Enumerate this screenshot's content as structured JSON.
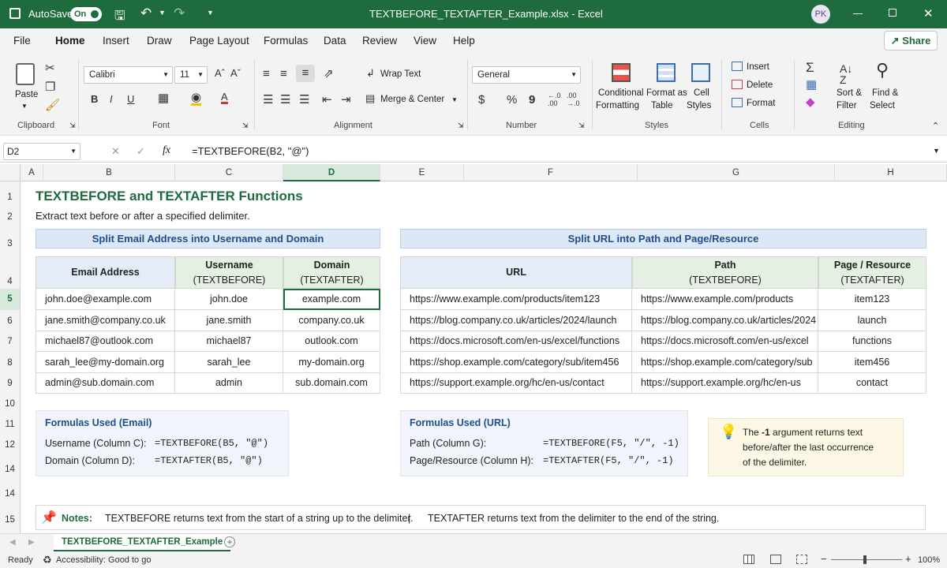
{
  "titlebar": {
    "autosave_label": "AutoSave",
    "autosave_state": "On",
    "title": "TEXTBEFORE_TEXTAFTER_Example.xlsx  -  Excel",
    "user_initials": "PK"
  },
  "ribbon_tabs": [
    "File",
    "Home",
    "Insert",
    "Draw",
    "Page Layout",
    "Formulas",
    "Data",
    "Review",
    "View",
    "Help"
  ],
  "share_label": "Share",
  "ribbon": {
    "clipboard": {
      "paste": "Paste",
      "label": "Clipboard"
    },
    "font": {
      "name": "Calibri",
      "size": "11",
      "label": "Font",
      "bold": "B",
      "italic": "I",
      "underline": "U"
    },
    "alignment": {
      "wrap": "Wrap Text",
      "merge": "Merge & Center",
      "label": "Alignment"
    },
    "number": {
      "format": "General",
      "currency": "$",
      "percent": "%",
      "comma": "9",
      "label": "Number"
    },
    "styles": {
      "cond1": "Conditional",
      "cond2": "Formatting",
      "table1": "Format as",
      "table2": "Table",
      "cell1": "Cell",
      "cell2": "Styles",
      "label": "Styles"
    },
    "cells": {
      "insert": "Insert",
      "delete": "Delete",
      "format": "Format",
      "label": "Cells"
    },
    "editing": {
      "sort1": "Sort &",
      "sort2": "Filter",
      "find1": "Find &",
      "find2": "Select",
      "label": "Editing"
    }
  },
  "formula_bar": {
    "name_box": "D2",
    "formula": "=TEXTBEFORE(B2, \"@\")"
  },
  "columns": [
    "A",
    "B",
    "C",
    "D",
    "E",
    "F",
    "G",
    "H"
  ],
  "rows": [
    "1",
    "2",
    "3",
    "4",
    "5",
    "6",
    "7",
    "8",
    "9",
    "10",
    "11",
    "12",
    "14",
    "14",
    "15"
  ],
  "sheet": {
    "title": "TEXTBEFORE and TEXTAFTER Functions",
    "subtitle": "Extract text before or after a specified delimiter.",
    "email_band": "Split Email Address into Username and Domain",
    "url_band": "Split URL into Path and Page/Resource",
    "email_headers": {
      "email": "Email Address",
      "user1": "Username",
      "user2": "(TEXTBEFORE)",
      "dom1": "Domain",
      "dom2": "(TEXTAFTER)"
    },
    "url_headers": {
      "url": "URL",
      "path1": "Path",
      "path2": "(TEXTBEFORE)",
      "page1": "Page / Resource",
      "page2": "(TEXTAFTER)"
    },
    "email_rows": [
      [
        "john.doe@example.com",
        "john.doe",
        "example.com"
      ],
      [
        "jane.smith@company.co.uk",
        "jane.smith",
        "company.co.uk"
      ],
      [
        "michael87@outlook.com",
        "michael87",
        "outlook.com"
      ],
      [
        "sarah_lee@my-domain.org",
        "sarah_lee",
        "my-domain.org"
      ],
      [
        "admin@sub.domain.com",
        "admin",
        "sub.domain.com"
      ]
    ],
    "url_rows": [
      [
        "https://www.example.com/products/item123",
        "https://www.example.com/products",
        "item123"
      ],
      [
        "https://blog.company.co.uk/articles/2024/launch",
        "https://blog.company.co.uk/articles/2024",
        "launch"
      ],
      [
        "https://docs.microsoft.com/en-us/excel/functions",
        "https://docs.microsoft.com/en-us/excel",
        "functions"
      ],
      [
        "https://shop.example.com/category/sub/item456",
        "https://shop.example.com/category/sub",
        "item456"
      ],
      [
        "https://support.example.org/hc/en-us/contact",
        "https://support.example.org/hc/en-us",
        "contact"
      ]
    ],
    "email_formulas": {
      "title": "Formulas Used (Email)",
      "l1": "Username (Column C):",
      "f1": "=TEXTBEFORE(B5, \"@\")",
      "l2": "Domain (Column D):",
      "f2": "=TEXTAFTER(B5, \"@\")"
    },
    "url_formulas": {
      "title": "Formulas Used (URL)",
      "l1": "Path (Column G):",
      "f1": "=TEXTBEFORE(F5, \"/\", -1)",
      "l2": "Page/Resource (Column H):",
      "f2": "=TEXTAFTER(F5, \"/\", -1)"
    },
    "tip": {
      "pre": "The ",
      "bold": "-1",
      "post": " argument returns text",
      "line2": "before/after the last occurrence",
      "line3": "of the delimiter."
    },
    "notes": {
      "label": "Notes:",
      "n1": "TEXTBEFORE returns text from the start of a string up to the delimiter.",
      "divider": "|",
      "n2": "TEXTAFTER returns text from the delimiter to the end of the string."
    }
  },
  "sheet_tab": "TEXTBEFORE_TEXTAFTER_Example",
  "status": {
    "ready": "Ready",
    "accessibility": "Accessibility: Good to go",
    "zoom": "100%"
  },
  "colors": {
    "accent": "#1e6b3d",
    "band": "#dce8f6",
    "header_green": "#e4f0e2",
    "header_blue": "#e3ecf7",
    "tip": "#fdf8e6"
  }
}
